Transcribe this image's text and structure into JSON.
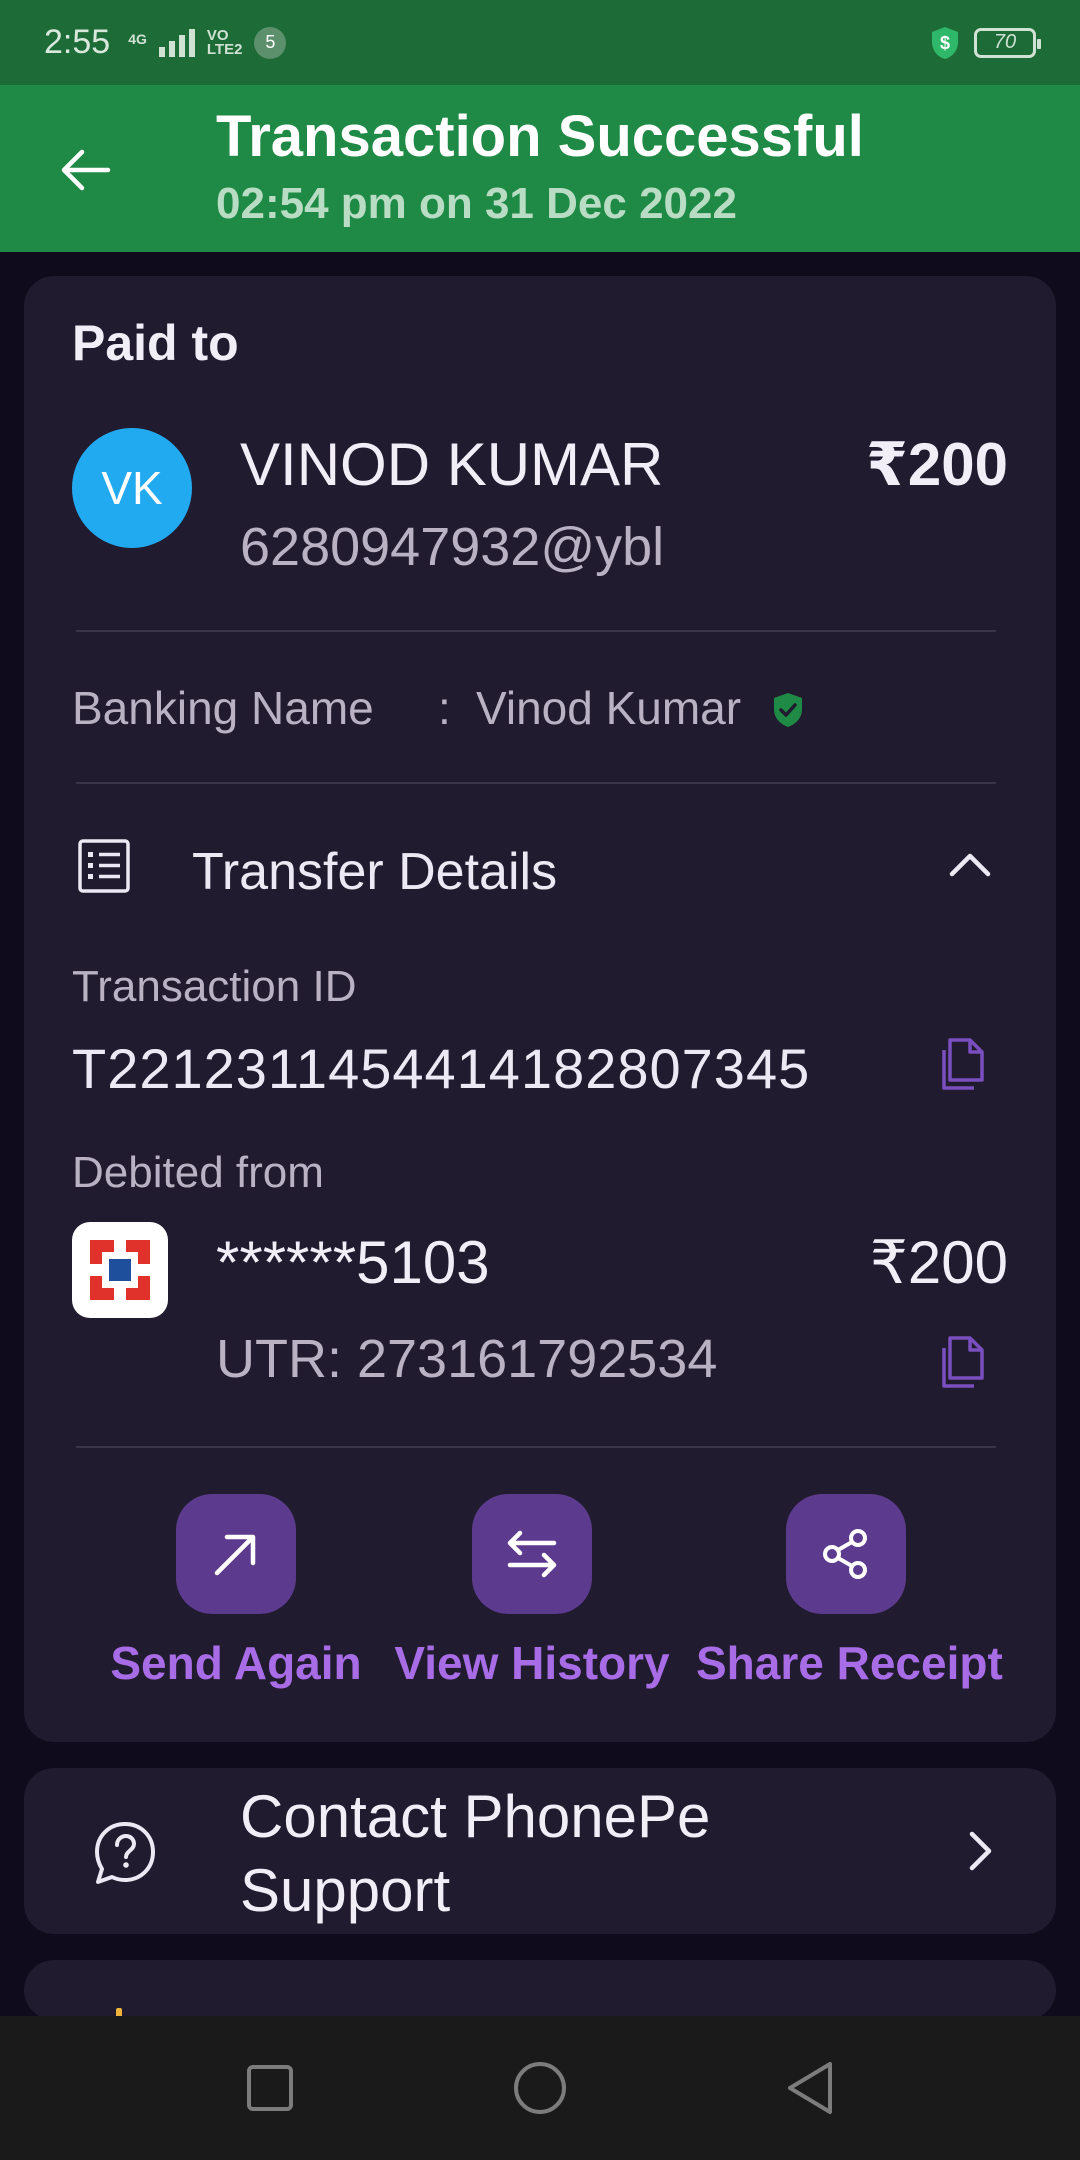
{
  "status_bar": {
    "time": "2:55",
    "network": "4G",
    "volte_line1": "VO",
    "volte_line2": "LTE2",
    "notification_count": "5",
    "battery": "70"
  },
  "header": {
    "title": "Transaction Successful",
    "subtitle": "02:54 pm on 31 Dec 2022"
  },
  "payment": {
    "paid_to_label": "Paid to",
    "avatar_initials": "VK",
    "payee_name": "VINOD KUMAR",
    "amount": "₹200",
    "upi_id": "6280947932@ybl",
    "banking_name_label": "Banking Name",
    "banking_name_colon": ":",
    "banking_name": "Vinod Kumar"
  },
  "transfer_details": {
    "title": "Transfer Details",
    "transaction_id_label": "Transaction ID",
    "transaction_id": "T2212311454414182807345",
    "debited_from_label": "Debited from",
    "account": "******5103",
    "debited_amount": "₹200",
    "utr": "UTR: 273161792534"
  },
  "actions": [
    {
      "label": "Send Again",
      "icon": "arrow-up-right-icon"
    },
    {
      "label": "View History",
      "icon": "swap-arrows-icon"
    },
    {
      "label": "Share Receipt",
      "icon": "share-icon"
    }
  ],
  "support": {
    "label": "Contact PhonePe Support"
  },
  "colors": {
    "header_green": "#1f8a45",
    "status_green": "#1d6b37",
    "card_bg": "#201b2e",
    "page_bg": "#0f0a1c",
    "accent_purple": "#a86ce6",
    "action_button_bg": "#5c3a8e",
    "avatar_blue": "#22aaf0",
    "verified_green": "#1f8a45"
  }
}
